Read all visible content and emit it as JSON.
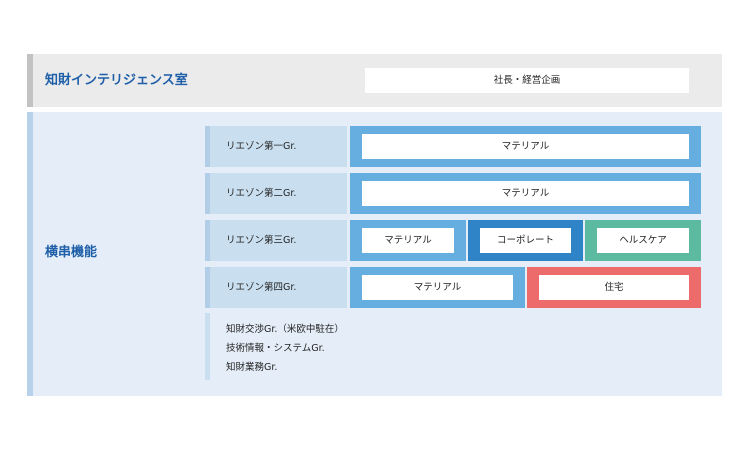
{
  "top": {
    "title": "知財インテリジェンス室",
    "box": "社長・経営企画"
  },
  "main": {
    "title": "横串機能",
    "groups": [
      {
        "label": "リエゾン第一Gr.",
        "boxes": [
          "マテリアル"
        ]
      },
      {
        "label": "リエゾン第二Gr.",
        "boxes": [
          "マテリアル"
        ]
      },
      {
        "label": "リエゾン第三Gr.",
        "boxes": [
          "マテリアル",
          "コーポレート",
          "ヘルスケア"
        ]
      },
      {
        "label": "リエゾン第四Gr.",
        "boxes": [
          "マテリアル",
          "住宅"
        ]
      }
    ],
    "others": [
      "知財交渉Gr.（米欧中駐在）",
      "技術情報・システムGr.",
      "知財業務Gr."
    ]
  },
  "colors": {
    "title_blue": "#1f5fa8",
    "frame_blue": "#66aee0",
    "frame_dark_blue": "#2e84c6",
    "frame_green": "#5bbaa0",
    "frame_red": "#ee6b6b"
  }
}
